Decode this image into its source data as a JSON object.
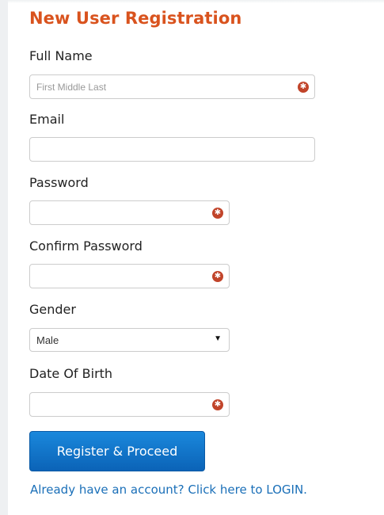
{
  "form": {
    "title": "New User Registration",
    "full_name": {
      "label": "Full Name",
      "placeholder": "First Middle Last",
      "value": ""
    },
    "email": {
      "label": "Email",
      "placeholder": "",
      "value": ""
    },
    "password": {
      "label": "Password",
      "value": ""
    },
    "confirm_password": {
      "label": "Confirm Password",
      "value": ""
    },
    "gender": {
      "label": "Gender",
      "selected": "Male",
      "caret": "▼"
    },
    "dob": {
      "label": "Date Of Birth",
      "value": ""
    },
    "required_icon": "asterisk-icon",
    "submit_label": "Register & Proceed",
    "login_link": "Already have an account? Click here to LOGIN."
  },
  "colors": {
    "title": "#d9531e",
    "required_icon": "#c1442a",
    "button": "#0b63b7",
    "link": "#1a6fb8"
  }
}
